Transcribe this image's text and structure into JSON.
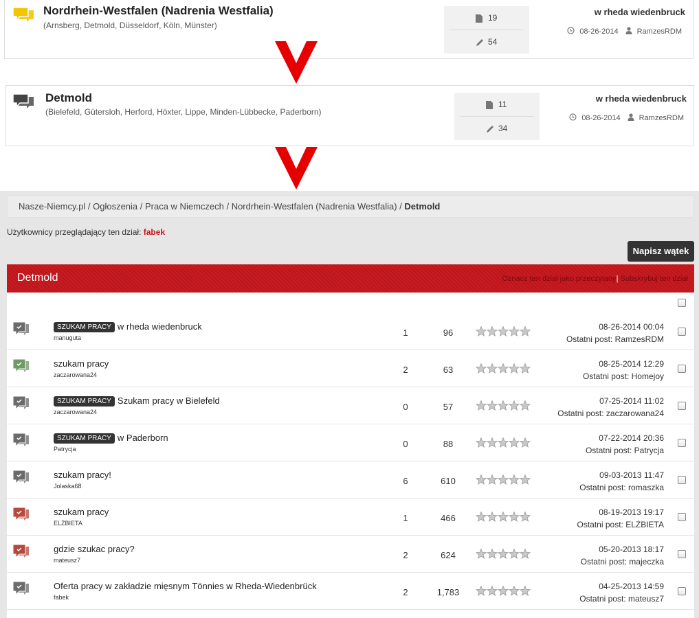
{
  "forum1": {
    "title": "Nordrhein-Westfalen (Nadrenia Westfalia)",
    "subforums": "(Arnsberg, Detmold, Düsseldorf, Köln, Münster)",
    "threads": "19",
    "posts": "54",
    "last_title": "w rheda wiedenbruck",
    "last_date": "08-26-2014",
    "last_user": "RamzesRDM",
    "icon_color": "#f2c500"
  },
  "forum2": {
    "title": "Detmold",
    "subforums": "(Bielefeld, Gütersloh, Herford, Höxter, Lippe, Minden-Lübbecke, Paderborn)",
    "threads": "11",
    "posts": "34",
    "last_title": "w rheda wiedenbruck",
    "last_date": "08-26-2014",
    "last_user": "RamzesRDM",
    "icon_color": "#555555"
  },
  "arrow_color": "#e60000",
  "breadcrumb": {
    "path": "Nasze-Niemcy.pl / Ogłoszenia / Praca w Niemczech / Nordrhein-Westfalen (Nadrenia Westfalia) / ",
    "current": "Detmold"
  },
  "viewers": {
    "label": "Użytkownicy przeglądający ten dział: ",
    "name": "fabek"
  },
  "new_thread_label": "Napisz wątek",
  "forum_header": {
    "title": "Detmold",
    "mark_read": "Oznacz ten dział jako przeczytany",
    "separator": "|",
    "subscribe": "Subskrybuj ten dział"
  },
  "threads": [
    {
      "prefix": "SZUKAM PRACY",
      "title": "w rheda wiedenbruck",
      "author": "manuguta",
      "replies": "1",
      "views": "96",
      "date": "08-26-2014 00:04",
      "last": "Ostatni post: RamzesRDM",
      "icon": "gray",
      "icon_color": "#6b6b6b"
    },
    {
      "prefix": "",
      "title": "szukam pracy",
      "author": "zaczarowana24",
      "replies": "2",
      "views": "63",
      "date": "08-25-2014 12:29",
      "last": "Ostatni post: Homejoy",
      "icon": "green",
      "icon_color": "#6f9a66"
    },
    {
      "prefix": "SZUKAM PRACY",
      "title": "Szukam pracy w Bielefeld",
      "author": "zaczarowana24",
      "replies": "0",
      "views": "57",
      "date": "07-25-2014 11:02",
      "last": "Ostatni post: zaczarowana24",
      "icon": "gray",
      "icon_color": "#6b6b6b"
    },
    {
      "prefix": "SZUKAM PRACY",
      "title": "w Paderborn",
      "author": "Patrycja",
      "replies": "0",
      "views": "88",
      "date": "07-22-2014 20:36",
      "last": "Ostatni post: Patrycja",
      "icon": "gray",
      "icon_color": "#6b6b6b"
    },
    {
      "prefix": "",
      "title": "szukam pracy!",
      "author": "Jolaska68",
      "replies": "6",
      "views": "610",
      "date": "09-03-2013 11:47",
      "last": "Ostatni post: romaszka",
      "icon": "gray",
      "icon_color": "#6b6b6b"
    },
    {
      "prefix": "",
      "title": "szukam pracy",
      "author": "ELŻBIETA",
      "replies": "1",
      "views": "466",
      "date": "08-19-2013 19:17",
      "last": "Ostatni post: ELŻBIETA",
      "icon": "red",
      "icon_color": "#b5493e"
    },
    {
      "prefix": "",
      "title": "gdzie szukac pracy?",
      "author": "mateusz7",
      "replies": "2",
      "views": "624",
      "date": "05-20-2013 18:17",
      "last": "Ostatni post: majeczka",
      "icon": "red",
      "icon_color": "#b5493e"
    },
    {
      "prefix": "",
      "title": "Oferta pracy w zakładzie mięsnym Tönnies w Rheda-Wiedenbrück",
      "author": "fabek",
      "replies": "2",
      "views": "1,783",
      "date": "04-25-2013 14:59",
      "last": "Ostatni post: mateusz7",
      "icon": "gray",
      "icon_color": "#6b6b6b"
    }
  ]
}
